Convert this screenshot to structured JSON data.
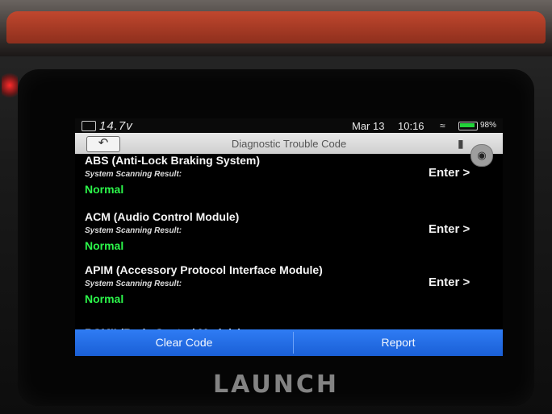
{
  "status": {
    "voltage": "14.7v",
    "date": "Mar 13",
    "time": "10:16",
    "battery_pct": "98%"
  },
  "header": {
    "back_icon": "back-arrow-icon",
    "title": "Diagnostic Trouble Code",
    "camera_icon": "camera-icon"
  },
  "modules": [
    {
      "name": "ABS (Anti-Lock Braking System)",
      "scan_label": "System Scanning Result:",
      "result": "Normal",
      "action": "Enter >"
    },
    {
      "name": "ACM (Audio Control Module)",
      "scan_label": "System Scanning Result:",
      "result": "Normal",
      "action": "Enter >"
    },
    {
      "name": "APIM (Accessory Protocol Interface Module)",
      "scan_label": "System Scanning Result:",
      "result": "Normal",
      "action": "Enter >"
    },
    {
      "name": "BCMII (Body Control Module)"
    }
  ],
  "footer": {
    "clear_code": "Clear Code",
    "report": "Report"
  },
  "device": {
    "brand": "LAUNCH"
  },
  "colors": {
    "result_ok": "#2cf54a",
    "accent_bar": "#1a5fd6"
  }
}
